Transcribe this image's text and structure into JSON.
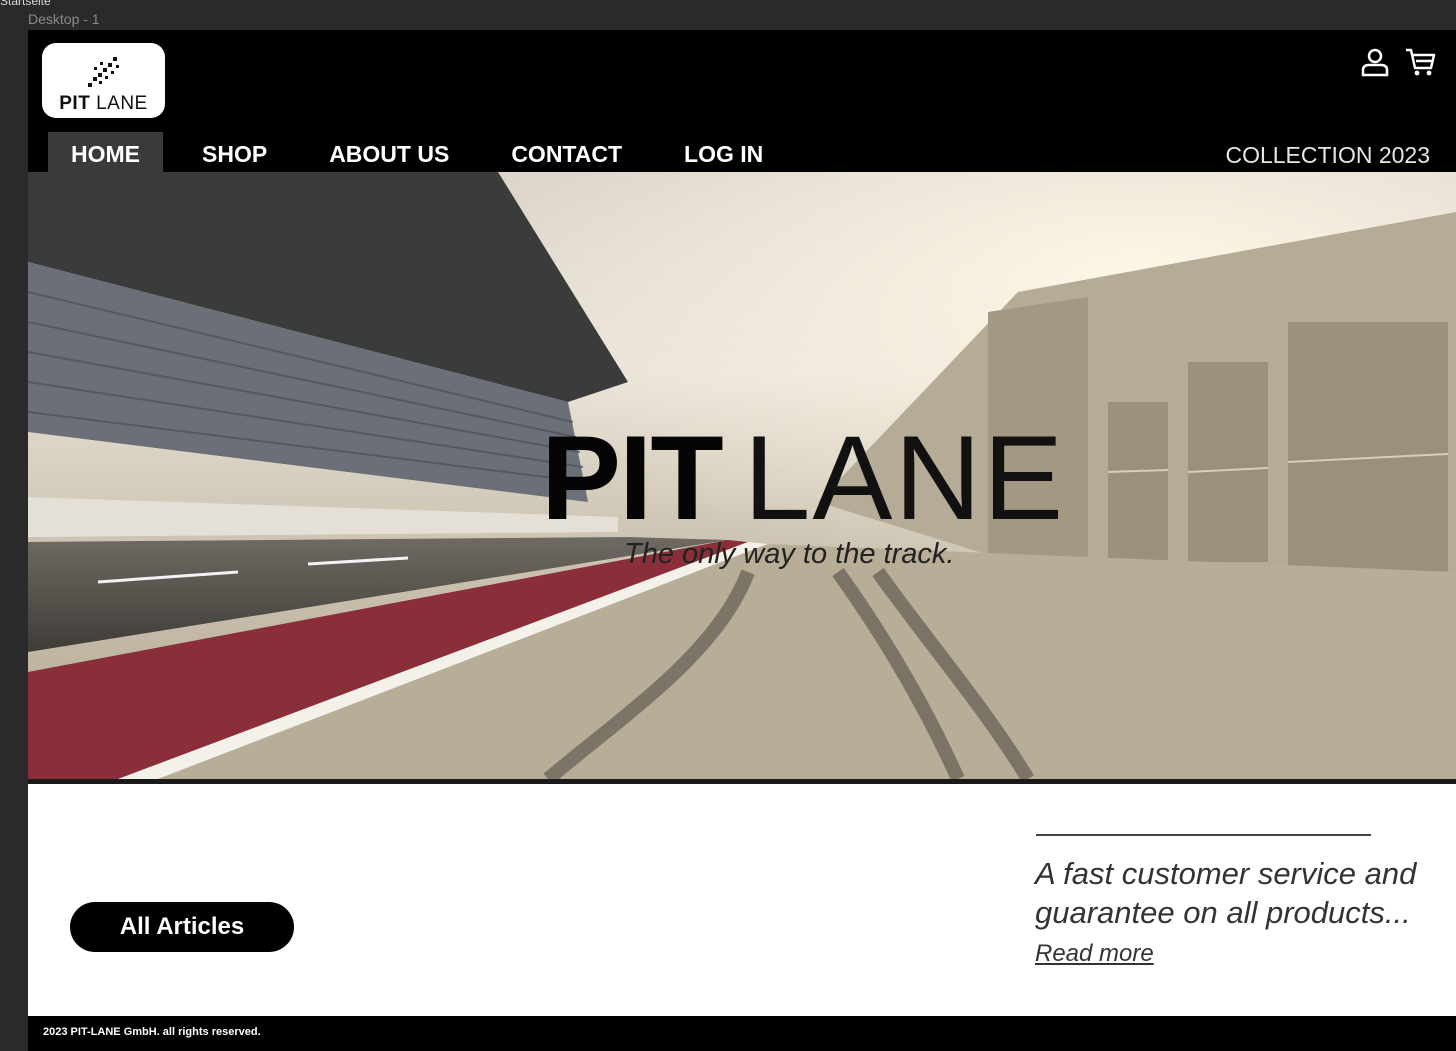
{
  "page_label": "Startseite",
  "frame_label": "Desktop - 1",
  "logo": {
    "bold": "PIT",
    "light": "LANE"
  },
  "header_icons": [
    "user-icon",
    "cart-icon"
  ],
  "nav": [
    {
      "label": "HOME",
      "active": true
    },
    {
      "label": "SHOP"
    },
    {
      "label": "ABOUT US"
    },
    {
      "label": "CONTACT"
    },
    {
      "label": "LOG IN"
    }
  ],
  "collection": "COLLECTION 2023",
  "hero": {
    "title_bold": "PIT",
    "title_light": "LANE",
    "tagline": "The only way to the track."
  },
  "cta": {
    "label": "All Articles"
  },
  "promo": {
    "text": "A fast customer service and guarantee on all products...",
    "link": "Read more"
  },
  "footer": {
    "text": "2023 PIT-LANE GmbH. all rights reserved."
  }
}
